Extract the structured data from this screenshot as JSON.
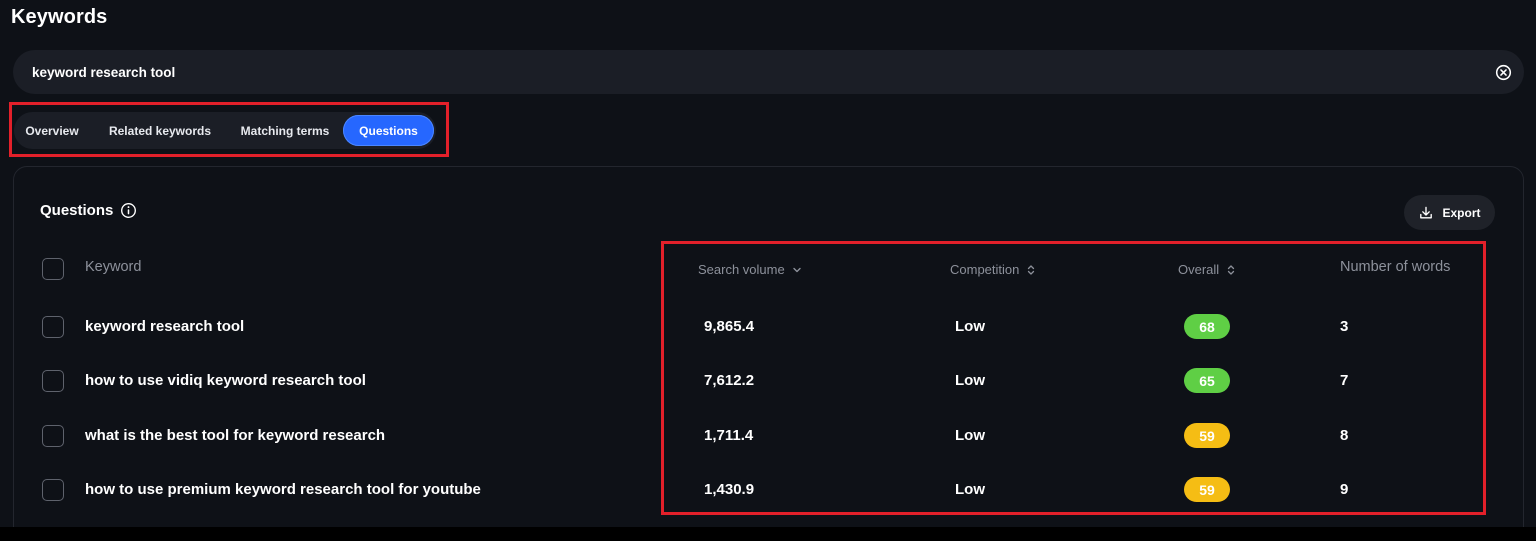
{
  "page": {
    "title": "Keywords"
  },
  "search": {
    "value": "keyword research tool"
  },
  "tabs": [
    {
      "label": "Overview",
      "active": false
    },
    {
      "label": "Related keywords",
      "active": false
    },
    {
      "label": "Matching terms",
      "active": false
    },
    {
      "label": "Questions",
      "active": true
    }
  ],
  "section": {
    "title": "Questions",
    "export_label": "Export"
  },
  "table": {
    "headers": {
      "keyword": "Keyword",
      "search_volume": "Search volume",
      "competition": "Competition",
      "overall": "Overall",
      "words": "Number of words"
    },
    "rows": [
      {
        "keyword": "keyword research tool",
        "search_volume": "9,865.4",
        "competition": "Low",
        "overall": "68",
        "words": "3"
      },
      {
        "keyword": "how to use vidiq keyword research tool",
        "search_volume": "7,612.2",
        "competition": "Low",
        "overall": "65",
        "words": "7"
      },
      {
        "keyword": "what is the best tool for keyword research",
        "search_volume": "1,711.4",
        "competition": "Low",
        "overall": "59",
        "words": "8"
      },
      {
        "keyword": "how to use premium keyword research tool for youtube",
        "search_volume": "1,430.9",
        "competition": "Low",
        "overall": "59",
        "words": "9"
      }
    ]
  },
  "colors": {
    "background": "#0e1117",
    "surface": "#1b1e26",
    "accent": "#2667ff",
    "highlight": "#e3202a",
    "score_green": "#5fcf45",
    "score_yellow": "#f5bd14"
  }
}
